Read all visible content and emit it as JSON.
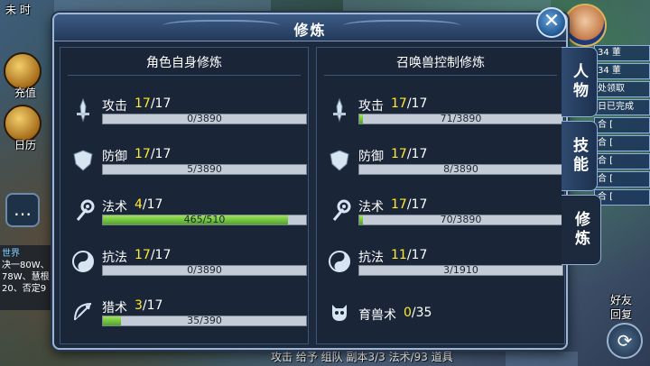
{
  "dialog": {
    "title": "修炼",
    "close_label": "✕"
  },
  "tabs": [
    {
      "label": "人物",
      "active": false
    },
    {
      "label": "技能",
      "active": false
    },
    {
      "label": "修炼",
      "active": true
    }
  ],
  "left_panel": {
    "header": "角色自身修炼",
    "skills": [
      {
        "name": "攻击",
        "level": "17",
        "max": "/17",
        "progress_text": "0/3890",
        "progress": 0.0,
        "icon": "sword-icon"
      },
      {
        "name": "防御",
        "level": "17",
        "max": "/17",
        "progress_text": "5/3890",
        "progress": 0.0013,
        "icon": "shield-icon"
      },
      {
        "name": "法术",
        "level": "4",
        "max": "/17",
        "progress_text": "465/510",
        "progress": 0.912,
        "icon": "staff-icon"
      },
      {
        "name": "抗法",
        "level": "17",
        "max": "/17",
        "progress_text": "0/3890",
        "progress": 0.0,
        "icon": "yinyang-icon"
      },
      {
        "name": "猎术",
        "level": "3",
        "max": "/17",
        "progress_text": "35/390",
        "progress": 0.09,
        "icon": "bow-icon"
      }
    ]
  },
  "right_panel": {
    "header": "召唤兽控制修炼",
    "skills": [
      {
        "name": "攻击",
        "level": "17",
        "max": "/17",
        "progress_text": "71/3890",
        "progress": 0.018,
        "icon": "sword-icon"
      },
      {
        "name": "防御",
        "level": "17",
        "max": "/17",
        "progress_text": "8/3890",
        "progress": 0.002,
        "icon": "shield-icon"
      },
      {
        "name": "法术",
        "level": "17",
        "max": "/17",
        "progress_text": "70/3890",
        "progress": 0.018,
        "icon": "staff-icon"
      },
      {
        "name": "抗法",
        "level": "11",
        "max": "/17",
        "progress_text": "3/1910",
        "progress": 0.0016,
        "icon": "yinyang-icon"
      },
      {
        "name": "育兽术",
        "level": "0",
        "max": "/35",
        "icon": "beast-skull-icon"
      }
    ]
  },
  "background_hud": {
    "top_left": "未 时",
    "left_labels": [
      "充值",
      "日历"
    ],
    "world_label": "世界",
    "world_lines": [
      "决一80W、",
      "78W、慧根",
      "20、否定9"
    ],
    "right_rows": [
      "34 董",
      "34 董",
      "处领取",
      "日已完成",
      "合 [",
      "合 [",
      "合 [",
      "合 [",
      "合 ["
    ],
    "bottom_bar": "攻击  给予  组队  副本3/3 法术/93  道具",
    "right_hud": [
      "好友",
      "回复"
    ]
  },
  "colors": {
    "level_highlight": "#ffea2e",
    "bar_fill": "#6cc23a",
    "bar_track": "#c3ccd6",
    "dialog_bg": "#1d2a3d"
  }
}
